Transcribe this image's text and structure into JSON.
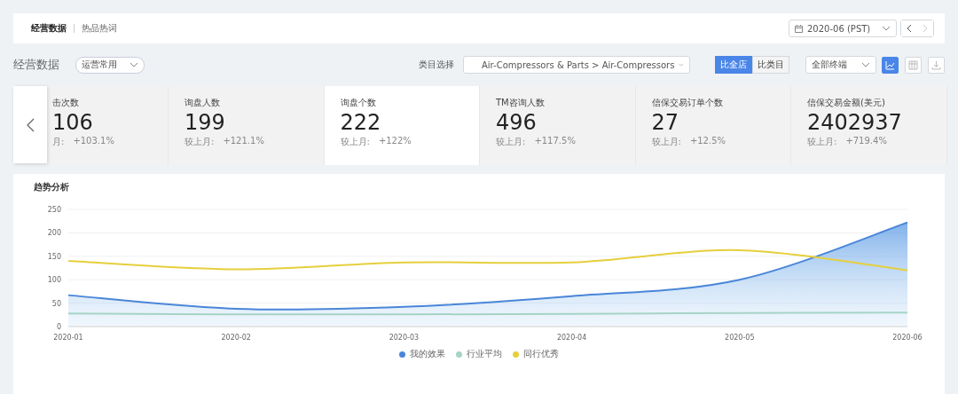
{
  "top_tabs": [
    {
      "label": "经营数据",
      "selected": true
    },
    {
      "label": "热品热词",
      "selected": false
    }
  ],
  "date_select": {
    "value": "2020-06 (PST)"
  },
  "section": {
    "title": "经营数据",
    "preset_select": "运营常用",
    "category_label": "类目选择",
    "category_select": "Air-Compressors & Parts > Air-Compressors"
  },
  "compare_toggle": [
    {
      "label": "比全店",
      "selected": true
    },
    {
      "label": "比类目",
      "selected": false
    }
  ],
  "terminal_select": "全部终端",
  "view_buttons": [
    {
      "kind": "chart",
      "selected": true
    },
    {
      "kind": "table",
      "selected": false
    },
    {
      "kind": "download",
      "selected": false
    }
  ],
  "metrics": [
    {
      "label": "击次数",
      "value": "106",
      "compare_label": "月:",
      "change": "+103.1%",
      "selected": false
    },
    {
      "label": "询盘人数",
      "value": "199",
      "compare_label": "较上月:",
      "change": "+121.1%",
      "selected": false
    },
    {
      "label": "询盘个数",
      "value": "222",
      "compare_label": "较上月:",
      "change": "+122%",
      "selected": true
    },
    {
      "label": "TM咨询人数",
      "value": "496",
      "compare_label": "较上月:",
      "change": "+117.5%",
      "selected": false
    },
    {
      "label": "信保交易订单个数",
      "value": "27",
      "compare_label": "较上月:",
      "change": "+12.5%",
      "selected": false
    },
    {
      "label": "信保交易金额(美元)",
      "value": "2402937",
      "compare_label": "较上月:",
      "change": "+719.4%",
      "selected": false
    }
  ],
  "trend": {
    "title": "趋势分析",
    "chart_data": {
      "type": "line",
      "grid": true,
      "categories": [
        "2020-01",
        "2020-02",
        "2020-03",
        "2020-04",
        "2020-05",
        "2020-06"
      ],
      "ylim": [
        0,
        250
      ],
      "yticks": [
        0,
        50,
        100,
        150,
        200,
        250
      ],
      "series": [
        {
          "name": "我的效果",
          "color": "#4a86d8",
          "type": "area",
          "values": [
            67,
            38,
            42,
            65,
            100,
            222
          ]
        },
        {
          "name": "行业平均",
          "color": "#a6d4c6",
          "values": [
            28,
            26,
            26,
            27,
            29,
            30
          ]
        },
        {
          "name": "同行优秀",
          "color": "#e6cf3c",
          "values": [
            140,
            122,
            137,
            137,
            163,
            120
          ]
        }
      ]
    }
  }
}
